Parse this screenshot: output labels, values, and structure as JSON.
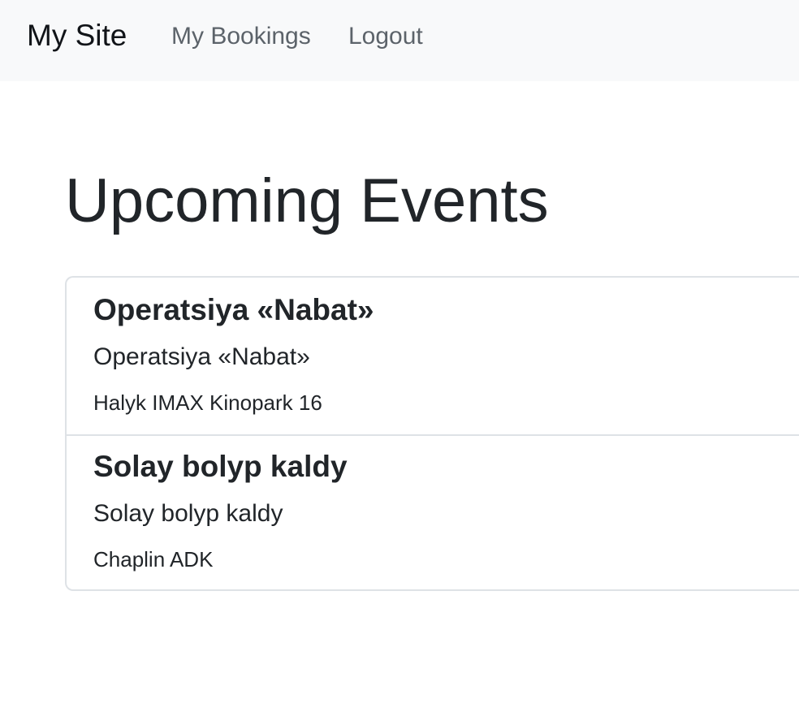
{
  "navbar": {
    "brand": "My Site",
    "links": [
      {
        "label": "My Bookings"
      },
      {
        "label": "Logout"
      }
    ]
  },
  "main": {
    "title": "Upcoming Events",
    "events": [
      {
        "title": "Operatsiya «Nabat»",
        "subtitle": "Operatsiya «Nabat»",
        "venue": "Halyk IMAX Kinopark 16"
      },
      {
        "title": "Solay bolyp kaldy",
        "subtitle": "Solay bolyp kaldy",
        "venue": "Chaplin ADK"
      }
    ]
  },
  "colors": {
    "navbar_bg": "#f8f9fa",
    "nav_link": "#5c636a",
    "text": "#212529",
    "border": "#dee2e6"
  }
}
